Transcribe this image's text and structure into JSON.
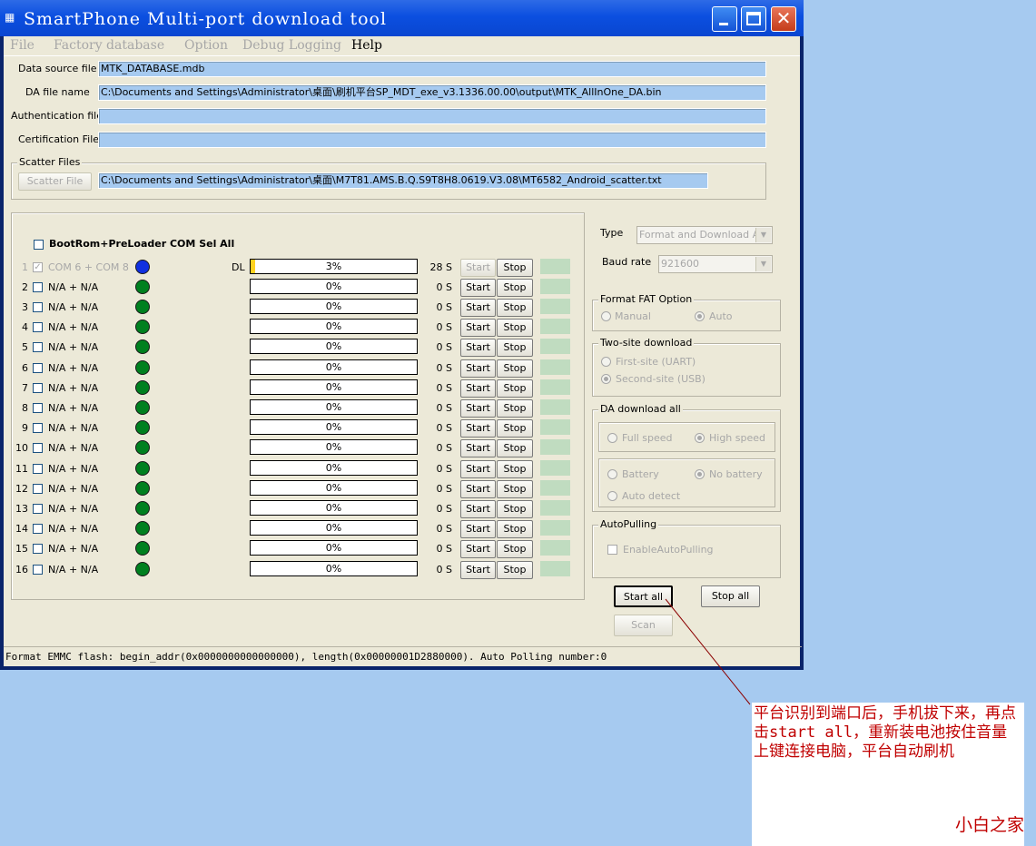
{
  "window": {
    "title": "SmartPhone Multi-port download tool",
    "title_icon": "phone-icon"
  },
  "menu": [
    {
      "label": "File",
      "enabled": false
    },
    {
      "label": "Factory database",
      "enabled": false
    },
    {
      "label": "Option",
      "enabled": false
    },
    {
      "label": "Debug Logging",
      "enabled": false
    },
    {
      "label": "Help",
      "enabled": true
    }
  ],
  "files": {
    "data_source_label": "Data source file",
    "data_source_value": "MTK_DATABASE.mdb",
    "da_label": "DA file name",
    "da_value": "C:\\Documents and Settings\\Administrator\\桌面\\刷机平台SP_MDT_exe_v3.1336.00.00\\output\\MTK_AllInOne_DA.bin",
    "auth_label": "Authentication file",
    "auth_value": "",
    "cert_label": "Certification File",
    "cert_value": ""
  },
  "scatter": {
    "group_title": "Scatter Files",
    "button_label": "Scatter File",
    "value": "C:\\Documents and Settings\\Administrator\\桌面\\M7T81.AMS.B.Q.S9T8H8.0619.V3.08\\MT6582_Android_scatter.txt"
  },
  "ports": {
    "sel_all_label": "BootRom+PreLoader COM Sel All",
    "start_label": "Start",
    "stop_label": "Stop",
    "rows": [
      {
        "num": "1",
        "port": "COM 6 + COM 8",
        "mode": "DL",
        "pct": "3%",
        "progress": 0.03,
        "time": "28 S",
        "active": true
      },
      {
        "num": "2",
        "port": "N/A + N/A",
        "mode": "",
        "pct": "0%",
        "progress": 0,
        "time": "0 S",
        "active": false
      },
      {
        "num": "3",
        "port": "N/A + N/A",
        "mode": "",
        "pct": "0%",
        "progress": 0,
        "time": "0 S",
        "active": false
      },
      {
        "num": "4",
        "port": "N/A + N/A",
        "mode": "",
        "pct": "0%",
        "progress": 0,
        "time": "0 S",
        "active": false
      },
      {
        "num": "5",
        "port": "N/A + N/A",
        "mode": "",
        "pct": "0%",
        "progress": 0,
        "time": "0 S",
        "active": false
      },
      {
        "num": "6",
        "port": "N/A + N/A",
        "mode": "",
        "pct": "0%",
        "progress": 0,
        "time": "0 S",
        "active": false
      },
      {
        "num": "7",
        "port": "N/A + N/A",
        "mode": "",
        "pct": "0%",
        "progress": 0,
        "time": "0 S",
        "active": false
      },
      {
        "num": "8",
        "port": "N/A + N/A",
        "mode": "",
        "pct": "0%",
        "progress": 0,
        "time": "0 S",
        "active": false
      },
      {
        "num": "9",
        "port": "N/A + N/A",
        "mode": "",
        "pct": "0%",
        "progress": 0,
        "time": "0 S",
        "active": false
      },
      {
        "num": "10",
        "port": "N/A + N/A",
        "mode": "",
        "pct": "0%",
        "progress": 0,
        "time": "0 S",
        "active": false
      },
      {
        "num": "11",
        "port": "N/A + N/A",
        "mode": "",
        "pct": "0%",
        "progress": 0,
        "time": "0 S",
        "active": false
      },
      {
        "num": "12",
        "port": "N/A + N/A",
        "mode": "",
        "pct": "0%",
        "progress": 0,
        "time": "0 S",
        "active": false
      },
      {
        "num": "13",
        "port": "N/A + N/A",
        "mode": "",
        "pct": "0%",
        "progress": 0,
        "time": "0 S",
        "active": false
      },
      {
        "num": "14",
        "port": "N/A + N/A",
        "mode": "",
        "pct": "0%",
        "progress": 0,
        "time": "0 S",
        "active": false
      },
      {
        "num": "15",
        "port": "N/A + N/A",
        "mode": "",
        "pct": "0%",
        "progress": 0,
        "time": "0 S",
        "active": false
      },
      {
        "num": "16",
        "port": "N/A + N/A",
        "mode": "",
        "pct": "0%",
        "progress": 0,
        "time": "0 S",
        "active": false
      }
    ]
  },
  "options": {
    "type_label": "Type",
    "type_value": "Format and Download All",
    "baud_label": "Baud rate",
    "baud_value": "921600",
    "fat_title": "Format FAT Option",
    "fat_manual": "Manual",
    "fat_auto": "Auto",
    "twosite_title": "Two-site download",
    "twosite_first": "First-site (UART)",
    "twosite_second": "Second-site (USB)",
    "da_title": "DA download all",
    "da_full": "Full speed",
    "da_high": "High speed",
    "da_battery": "Battery",
    "da_nobattery": "No battery",
    "da_autodetect": "Auto detect",
    "autopull_title": "AutoPulling",
    "autopull_check": "EnableAutoPulling"
  },
  "actions": {
    "start_all": "Start all",
    "stop_all": "Stop all",
    "scan": "Scan"
  },
  "status_text": "Format EMMC flash:  begin_addr(0x0000000000000000), length(0x00000001D2880000). Auto Polling number:0",
  "annotation": {
    "text": "平台识别到端口后，手机拔下来，再点击start all，重新装电池按住音量上键连接电脑，平台自动刷机",
    "brand": "小白之家"
  },
  "colors": {
    "desktop": "#A6CAF0",
    "titlebar": "#0B4FE0",
    "window_face": "#ECE9D8",
    "field_fill": "#A6CAF0",
    "port_dot_active": "#1030E0",
    "port_dot_idle": "#00801F",
    "progress_fill": "#FFD21F",
    "status_cell": "#C0DCC0",
    "annotation_text": "#C00000"
  }
}
